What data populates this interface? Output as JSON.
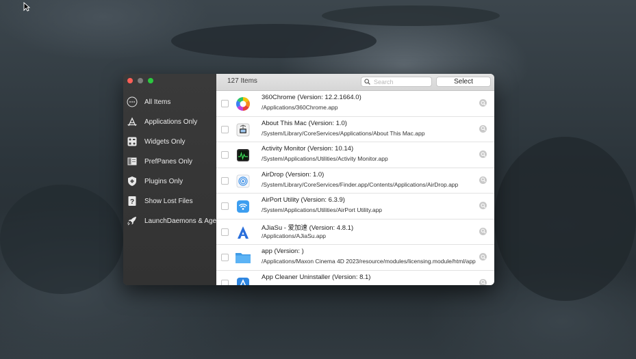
{
  "sidebar": {
    "items": [
      {
        "label": "All Items",
        "icon": "ellipsis-circle-icon"
      },
      {
        "label": "Applications Only",
        "icon": "app-store-icon"
      },
      {
        "label": "Widgets Only",
        "icon": "widgets-icon"
      },
      {
        "label": "PrefPanes Only",
        "icon": "prefpane-icon"
      },
      {
        "label": "Plugins Only",
        "icon": "plugin-shield-icon"
      },
      {
        "label": "Show Lost Files",
        "icon": "question-file-icon"
      },
      {
        "label": "LaunchDaemons & Agents",
        "icon": "rocket-icon"
      }
    ]
  },
  "toolbar": {
    "count": "127 Items",
    "search_placeholder": "Search",
    "select_label": "Select"
  },
  "rows": [
    {
      "name": "360Chrome (Version: 12.2.1664.0)",
      "path": "/Applications/360Chrome.app",
      "icon": "360chrome-icon"
    },
    {
      "name": "About This Mac (Version: 1.0)",
      "path": "/System/Library/CoreServices/Applications/About This Mac.app",
      "icon": "about-this-mac-icon"
    },
    {
      "name": "Activity Monitor (Version: 10.14)",
      "path": "/System/Applications/Utilities/Activity Monitor.app",
      "icon": "activity-monitor-icon"
    },
    {
      "name": "AirDrop (Version: 1.0)",
      "path": "/System/Library/CoreServices/Finder.app/Contents/Applications/AirDrop.app",
      "icon": "airdrop-icon"
    },
    {
      "name": "AirPort Utility (Version: 6.3.9)",
      "path": "/System/Applications/Utilities/AirPort Utility.app",
      "icon": "airport-utility-icon"
    },
    {
      "name": "AJiaSu - 爱加速 (Version: 4.8.1)",
      "path": "/Applications/AJiaSu.app",
      "icon": "ajiasu-icon"
    },
    {
      "name": "app (Version: )",
      "path": "/Applications/Maxon Cinema 4D 2023/resource/modules/licensing.module/html/app",
      "icon": "folder-icon"
    },
    {
      "name": "App Cleaner  Uninstaller (Version: 8.1)",
      "path": "",
      "icon": "app-cleaner-icon"
    }
  ],
  "colors": {
    "close": "#fe5f57",
    "minimize": "#7d7d7d",
    "zoom": "#2bc840",
    "sidebar_bg": "#353535"
  }
}
